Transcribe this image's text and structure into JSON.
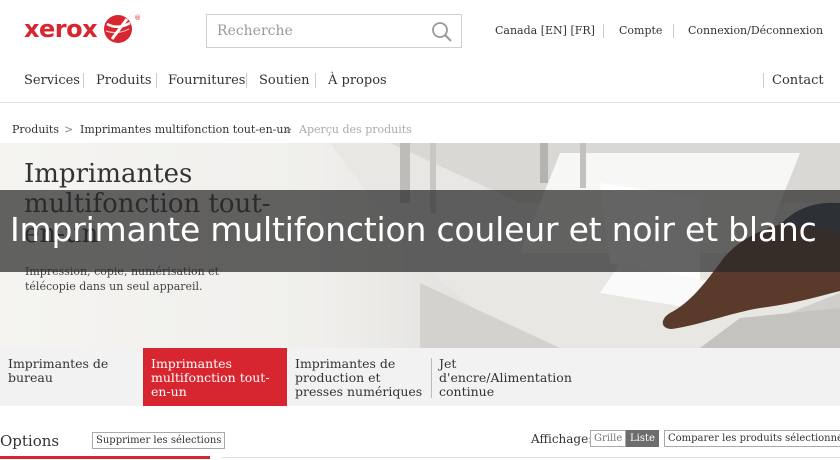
{
  "header": {
    "logo_text": "xerox",
    "search": {
      "placeholder": "Recherche"
    },
    "utility": {
      "locale": "Canada [EN] [FR]",
      "account": "Compte",
      "login": "Connexion/Déconnexion"
    },
    "nav": [
      "Services",
      "Produits",
      "Fournitures",
      "Soutien",
      "À propos"
    ],
    "contact": "Contact"
  },
  "breadcrumb": {
    "items": [
      "Produits",
      "Imprimantes multifonction tout-en-un",
      "Aperçu des produits"
    ],
    "separator": ">"
  },
  "hero": {
    "title": "Imprimantes multifonction tout-en-un",
    "subtitle": "Impression, copie, numérisation et télécopie dans un seul appareil.",
    "banner": "Imprimante multifonction couleur et noir et blanc"
  },
  "tabs": [
    {
      "label": "Imprimantes de bureau",
      "active": false
    },
    {
      "label": "Imprimantes multifonction tout-en-un",
      "active": true
    },
    {
      "label": "Imprimantes de production et presses numériques",
      "active": false
    },
    {
      "label": "Jet d'encre/Alimentation continue",
      "active": false
    }
  ],
  "options": {
    "title": "Options",
    "clear_selections": "Supprimer les sélections",
    "display_label": "Affichage:",
    "view_grid": "Grille",
    "view_list": "Liste",
    "compare": "Comparer les produits sélectionnés"
  },
  "colors": {
    "brand_red": "#d7262f",
    "banner_overlay": "#3a3a3a",
    "active_view": "#6d6d6d"
  }
}
